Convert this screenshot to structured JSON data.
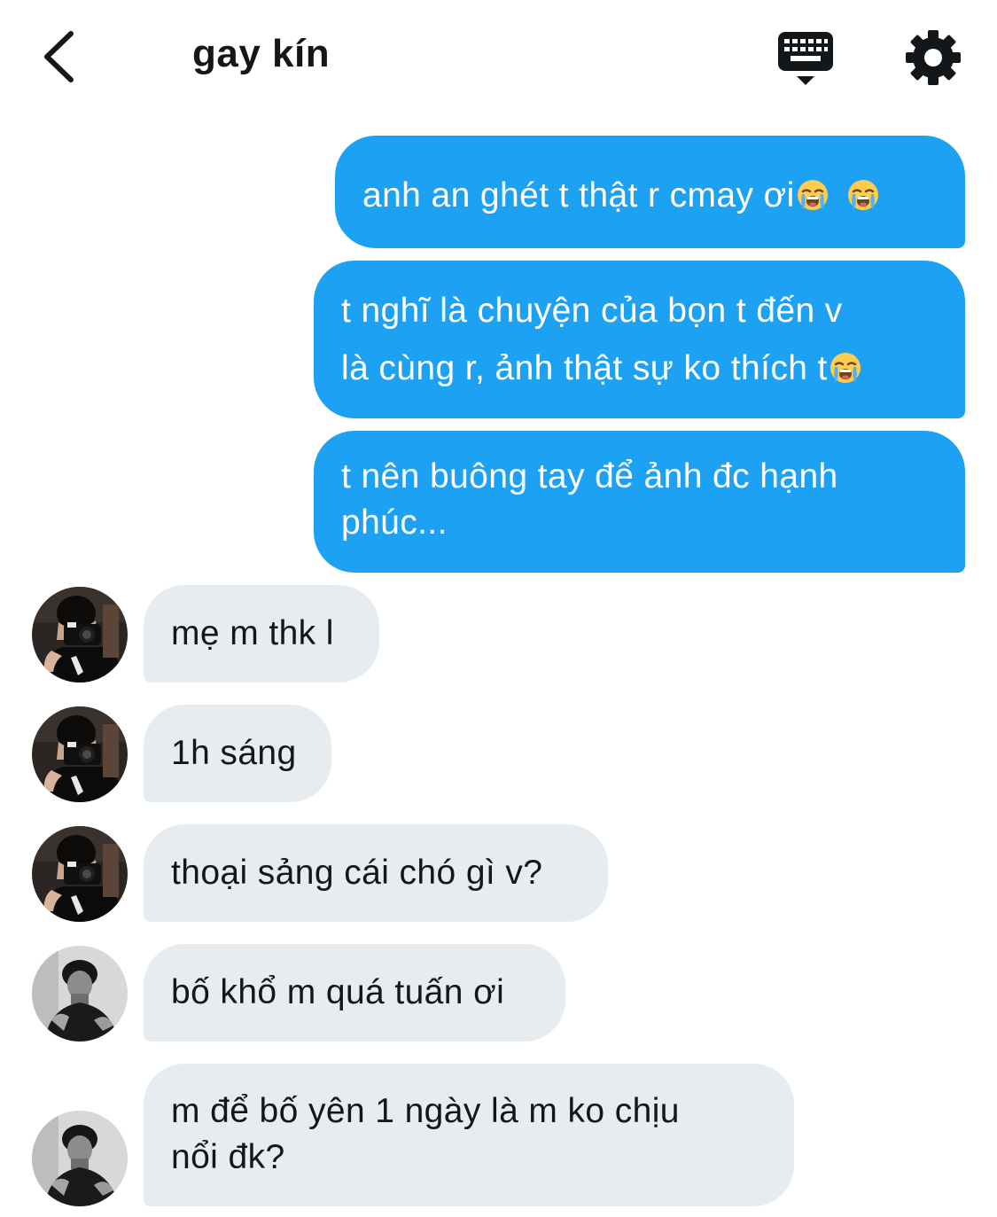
{
  "header": {
    "title": "gay kín",
    "back_icon": "chevron-left-icon",
    "keyboard_icon": "keyboard-icon",
    "settings_icon": "gear-icon"
  },
  "colors": {
    "outgoing_bubble": "#1da1f2",
    "incoming_bubble": "#e6ecf0",
    "text_dark": "#14171a"
  },
  "messages": [
    {
      "direction": "out",
      "text": "anh an ghét t thật r cmay ơi",
      "emojis": [
        "loudly-crying-face",
        "loudly-crying-face"
      ]
    },
    {
      "direction": "out",
      "line1": "t nghĩ là chuyện của bọn t đến v",
      "line2": "là cùng r, ảnh thật sự ko thích t",
      "emojis": [
        "loudly-crying-face"
      ]
    },
    {
      "direction": "out",
      "line1": "t nên buông tay để ảnh đc hạnh",
      "line2": "phúc..."
    },
    {
      "direction": "in",
      "text": "mẹ m thk l",
      "avatar": "avatar-camera"
    },
    {
      "direction": "in",
      "text": "1h sáng",
      "avatar": "avatar-camera"
    },
    {
      "direction": "in",
      "text": "thoại sảng cái chó gì v?",
      "avatar": "avatar-camera"
    },
    {
      "direction": "in",
      "text": "bố khổ m quá tuấn ơi",
      "avatar": "avatar-bw-portrait"
    },
    {
      "direction": "in",
      "line1": "m để bố yên 1 ngày là m ko chịu",
      "line2": "nổi đk?",
      "avatar": "avatar-bw-portrait"
    }
  ]
}
